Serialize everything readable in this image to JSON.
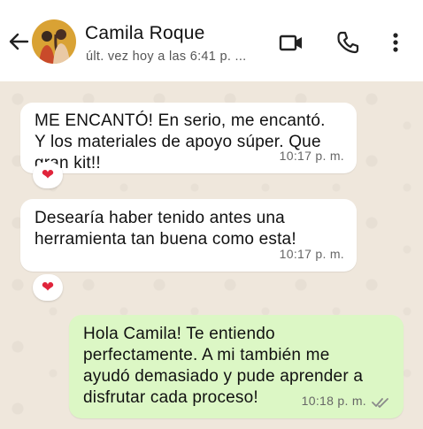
{
  "header": {
    "contact_name": "Camila Roque",
    "last_seen": "últ. vez hoy a las 6:41 p. ...",
    "icons": [
      "back-arrow-icon",
      "video-call-icon",
      "phone-call-icon",
      "more-vert-icon"
    ]
  },
  "messages": [
    {
      "direction": "incoming",
      "text": "ME ENCANTÓ! En serio, me encantó.\nY los materiales de apoyo súper. Que\ngran kit!!",
      "time": "10:17 p. m.",
      "reaction": "❤"
    },
    {
      "direction": "incoming",
      "text": "Desearía haber tenido antes una\nherramienta tan buena como esta!",
      "time": "10:17 p. m.",
      "reaction": "❤"
    },
    {
      "direction": "outgoing",
      "text": "Hola Camila! Te entiendo\nperfectamente. A mi también me\nayudó demasiado y pude aprender a\ndisfrutar cada proceso!",
      "time": "10:18 p. m.",
      "status": "read"
    }
  ],
  "colors": {
    "chat_background": "#efe7dc",
    "incoming_bubble": "#ffffff",
    "outgoing_bubble": "#dcf7c5",
    "reaction_heart": "#e0243b",
    "read_ticks": "#8a8a8a"
  }
}
